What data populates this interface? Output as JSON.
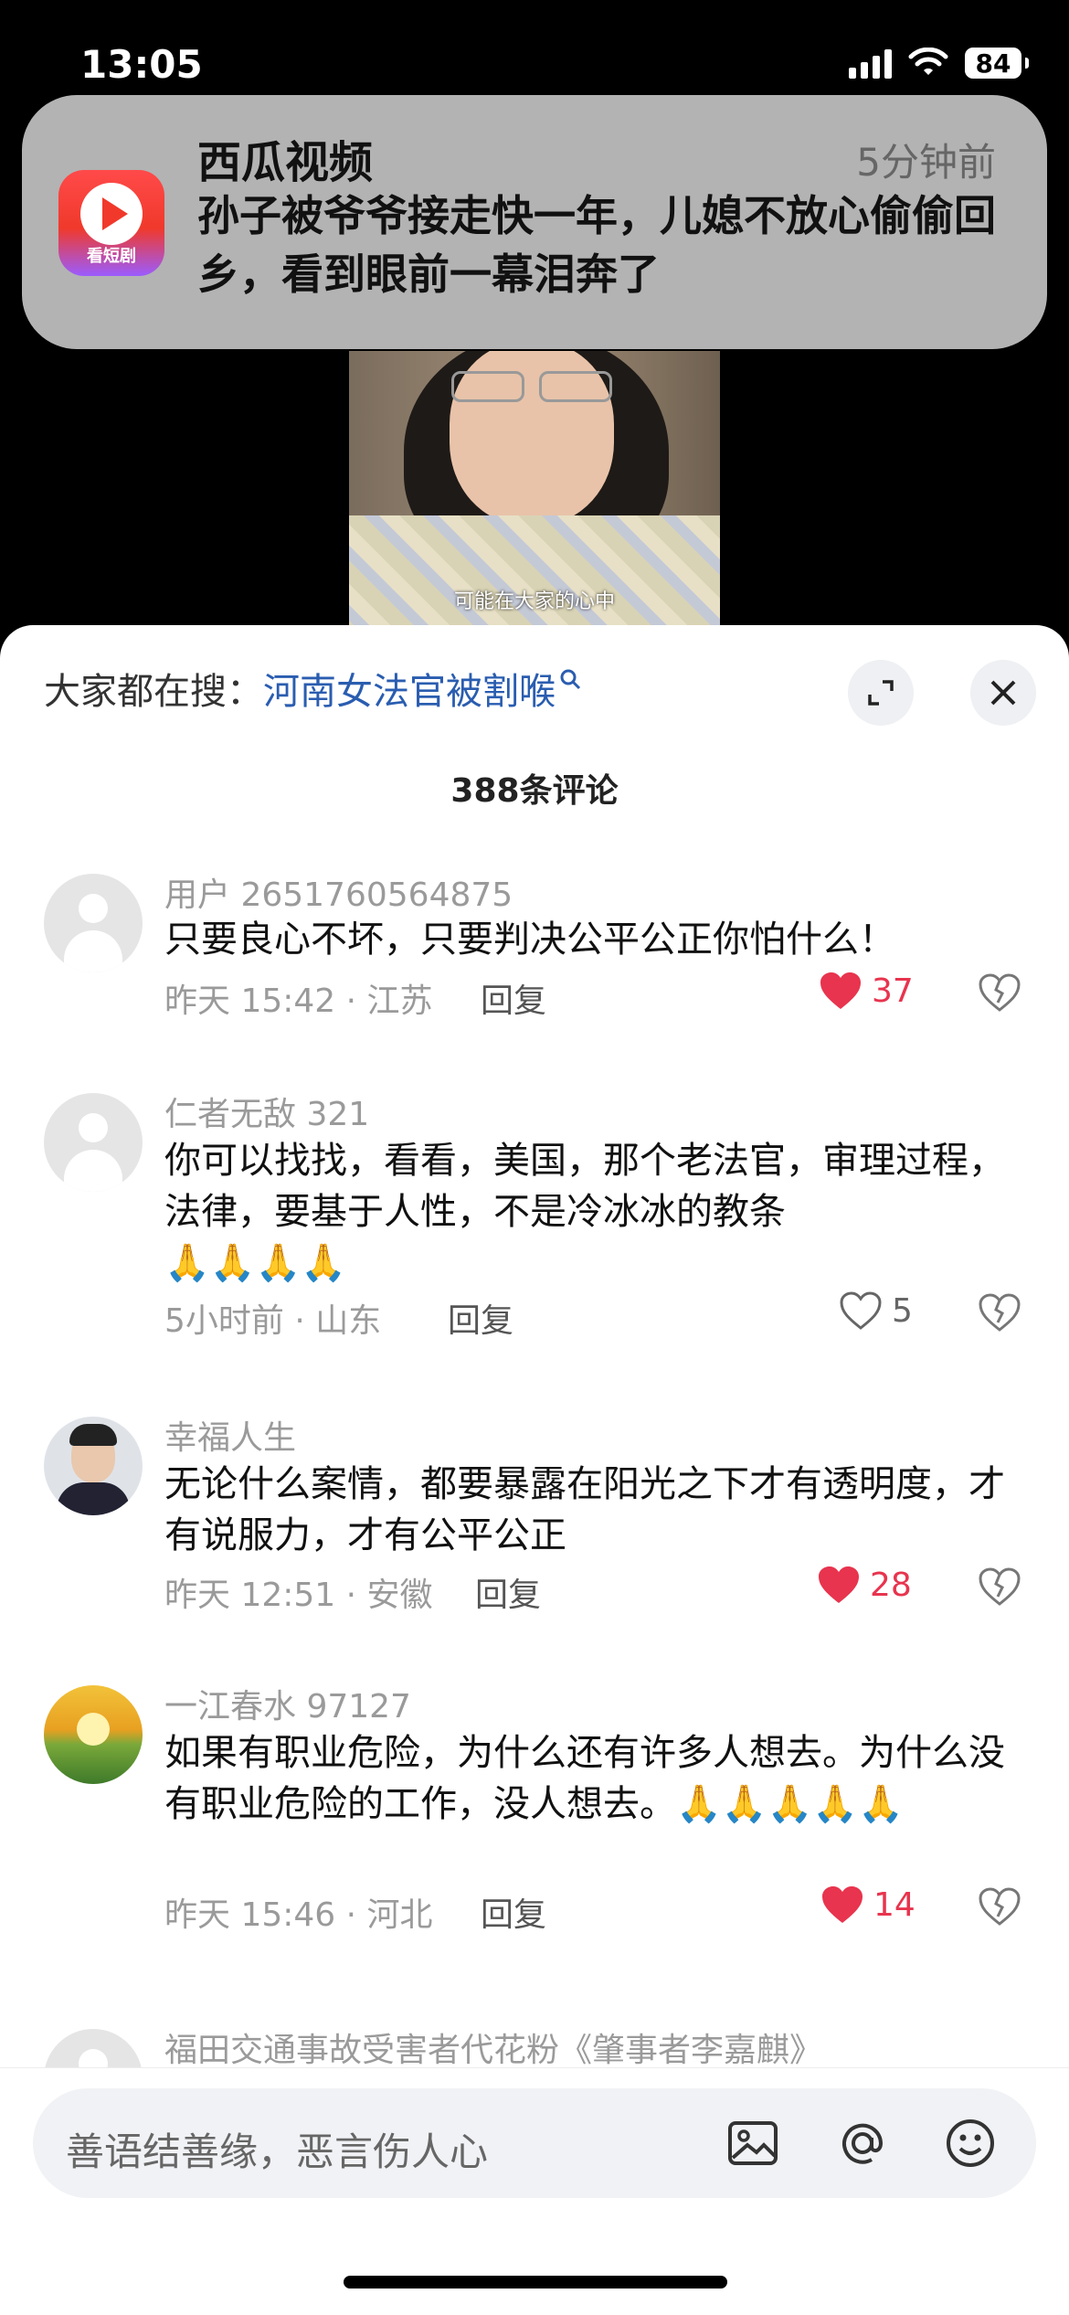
{
  "status_bar": {
    "time": "13:05",
    "battery": "84"
  },
  "notification": {
    "app": "西瓜视频",
    "icon_tag": "看短剧",
    "time": "5分钟前",
    "body": "孙子被爷爷接走快一年，儿媳不放心偷偷回乡，看到眼前一幕泪奔了"
  },
  "video": {
    "subtitle": "可能在大家的心中"
  },
  "sheet": {
    "search_prefix": "大家都在搜：",
    "search_term": "河南女法官被割喉",
    "comment_count": "388条评论"
  },
  "comments": [
    {
      "user": "用户 2651760564875",
      "text": "只要良心不坏，只要判决公平公正你怕什么！",
      "emoji": "",
      "time_loc": "昨天 15:42 · 江苏",
      "reply": "回复",
      "likes": "37",
      "liked": true
    },
    {
      "user": "仁者无敌 321",
      "text": "你可以找找，看看，美国，那个老法官，审理过程，法律，要基于人性，不是冷冰冰的教条",
      "emoji": "🙏🙏🙏🙏",
      "time_loc": "5小时前 · 山东",
      "reply": "回复",
      "likes": "5",
      "liked": false
    },
    {
      "user": "幸福人生",
      "text": "无论什么案情，都要暴露在阳光之下才有透明度，才有说服力，才有公平公正",
      "emoji": "",
      "time_loc": "昨天 12:51 · 安徽",
      "reply": "回复",
      "likes": "28",
      "liked": true
    },
    {
      "user": "一江春水 97127",
      "text": "如果有职业危险，为什么还有许多人想去。为什么没有职业危险的工作，没人想去。🙏🙏🙏🙏🙏",
      "emoji": "",
      "time_loc": "昨天 15:46 · 河北",
      "reply": "回复",
      "likes": "14",
      "liked": true
    },
    {
      "user": "福田交通事故受害者代花粉《肇事者李嘉麒》"
    }
  ],
  "input": {
    "placeholder": "善语结善缘，恶言伤人心"
  },
  "colors": {
    "accent_red": "#e8344e",
    "search_blue": "#2a5db0"
  },
  "icons": [
    "signal-icon",
    "wifi-icon",
    "battery-icon",
    "app-icon",
    "search-icon",
    "expand-icon",
    "close-icon",
    "heart-icon",
    "dislike-icon",
    "image-icon",
    "at-icon",
    "emoji-icon"
  ]
}
